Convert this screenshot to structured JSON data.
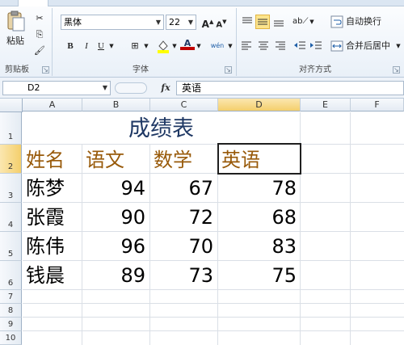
{
  "ribbon": {
    "clipboard": {
      "paste_label": "粘贴",
      "group_label": "剪贴板"
    },
    "font": {
      "name": "黑体",
      "size": "22",
      "grow": "A",
      "shrink": "A",
      "bold": "B",
      "italic": "I",
      "underline": "U",
      "border": "⊞",
      "fill_color": "#ffff00",
      "font_color_sample": "A",
      "font_color": "#c00000",
      "phonetic": "wén",
      "group_label": "字体"
    },
    "alignment": {
      "wrap_label": "自动换行",
      "merge_label": "合并后居中",
      "group_label": "对齐方式"
    }
  },
  "formula_bar": {
    "name_box": "D2",
    "fx": "fx",
    "content": "英语"
  },
  "sheet": {
    "columns": [
      "A",
      "B",
      "C",
      "D",
      "E",
      "F"
    ],
    "rows": [
      "1",
      "2",
      "3",
      "4",
      "5",
      "6",
      "7",
      "8",
      "9",
      "10"
    ],
    "title": "成绩表",
    "headers": [
      "姓名",
      "语文",
      "数学",
      "英语"
    ],
    "records": [
      {
        "name": "陈梦",
        "chinese": "94",
        "math": "67",
        "english": "78"
      },
      {
        "name": "张霞",
        "chinese": "90",
        "math": "72",
        "english": "68"
      },
      {
        "name": "陈伟",
        "chinese": "96",
        "math": "70",
        "english": "83"
      },
      {
        "name": "钱晨",
        "chinese": "89",
        "math": "73",
        "english": "75"
      }
    ]
  }
}
